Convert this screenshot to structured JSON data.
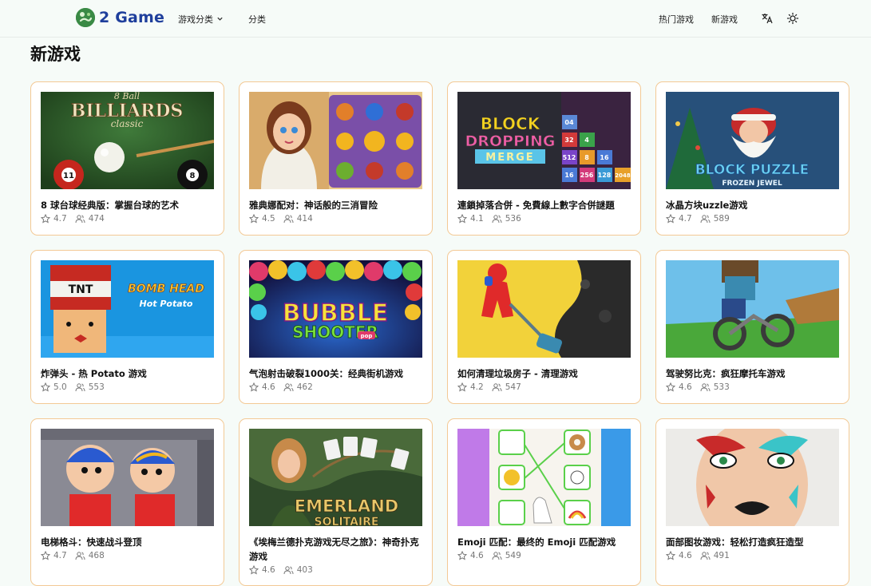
{
  "header": {
    "logo_text": "2 Game",
    "nav": [
      {
        "label": "游戏分类"
      },
      {
        "label": "分类"
      },
      {
        "label": "热门游戏"
      },
      {
        "label": "新游戏"
      }
    ]
  },
  "page_title": "新游戏",
  "games": [
    {
      "title": "8 球台球经典版：掌握台球的艺术",
      "rating": "4.7",
      "players": "474",
      "thumb_text": [
        "8 Ball",
        "BILLIARDS",
        "classic"
      ]
    },
    {
      "title": "雅典娜配对：神话般的三消冒险",
      "rating": "4.5",
      "players": "414",
      "thumb_text": []
    },
    {
      "title": "連鎖掉落合併 - 免費線上數字合併謎題",
      "rating": "4.1",
      "players": "536",
      "thumb_text": [
        "BLOCK",
        "DROPPING",
        "MERGE",
        "04",
        "32",
        "4",
        "512",
        "8",
        "16",
        "16",
        "256",
        "128",
        "2048"
      ]
    },
    {
      "title": "冰晶方块uzzle游戏",
      "rating": "4.7",
      "players": "589",
      "thumb_text": [
        "BLOCK PUZZLE",
        "FROZEN JEWEL"
      ]
    },
    {
      "title": "炸弹头 - 热 Potato 游戏",
      "rating": "5.0",
      "players": "553",
      "thumb_text": [
        "TNT",
        "BOMB HEAD",
        "Hot Potato"
      ]
    },
    {
      "title": "气泡射击破裂1000关：经典街机游戏",
      "rating": "4.6",
      "players": "462",
      "thumb_text": [
        "BUBBLE",
        "SHOOTER",
        "pop"
      ]
    },
    {
      "title": "如何清理垃圾房子 - 清理游戏",
      "rating": "4.2",
      "players": "547",
      "thumb_text": []
    },
    {
      "title": "驾驶努比克：疯狂摩托车游戏",
      "rating": "4.6",
      "players": "533",
      "thumb_text": []
    },
    {
      "title": "电梯格斗：快速战斗登顶",
      "rating": "4.7",
      "players": "468",
      "thumb_text": []
    },
    {
      "title": "《埃梅兰德扑克游戏无尽之旅》：神奇扑克游戏",
      "rating": "4.6",
      "players": "403",
      "thumb_text": [
        "EMERLAND",
        "SOLITAIRE"
      ]
    },
    {
      "title": "Emoji 匹配：最终的 Emoji 匹配游戏",
      "rating": "4.6",
      "players": "549",
      "thumb_text": []
    },
    {
      "title": "面部图妆游戏：轻松打造疯狂造型",
      "rating": "4.6",
      "players": "491",
      "thumb_text": []
    }
  ],
  "colors": {
    "card_border": "#f3c995",
    "logo_text": "#1f3f9c",
    "background": "#f6fbf8"
  },
  "icons": {
    "rating": "star-icon",
    "players": "users-icon",
    "language": "translate-icon",
    "theme": "sun-icon",
    "dropdown": "chevron-down-icon"
  }
}
